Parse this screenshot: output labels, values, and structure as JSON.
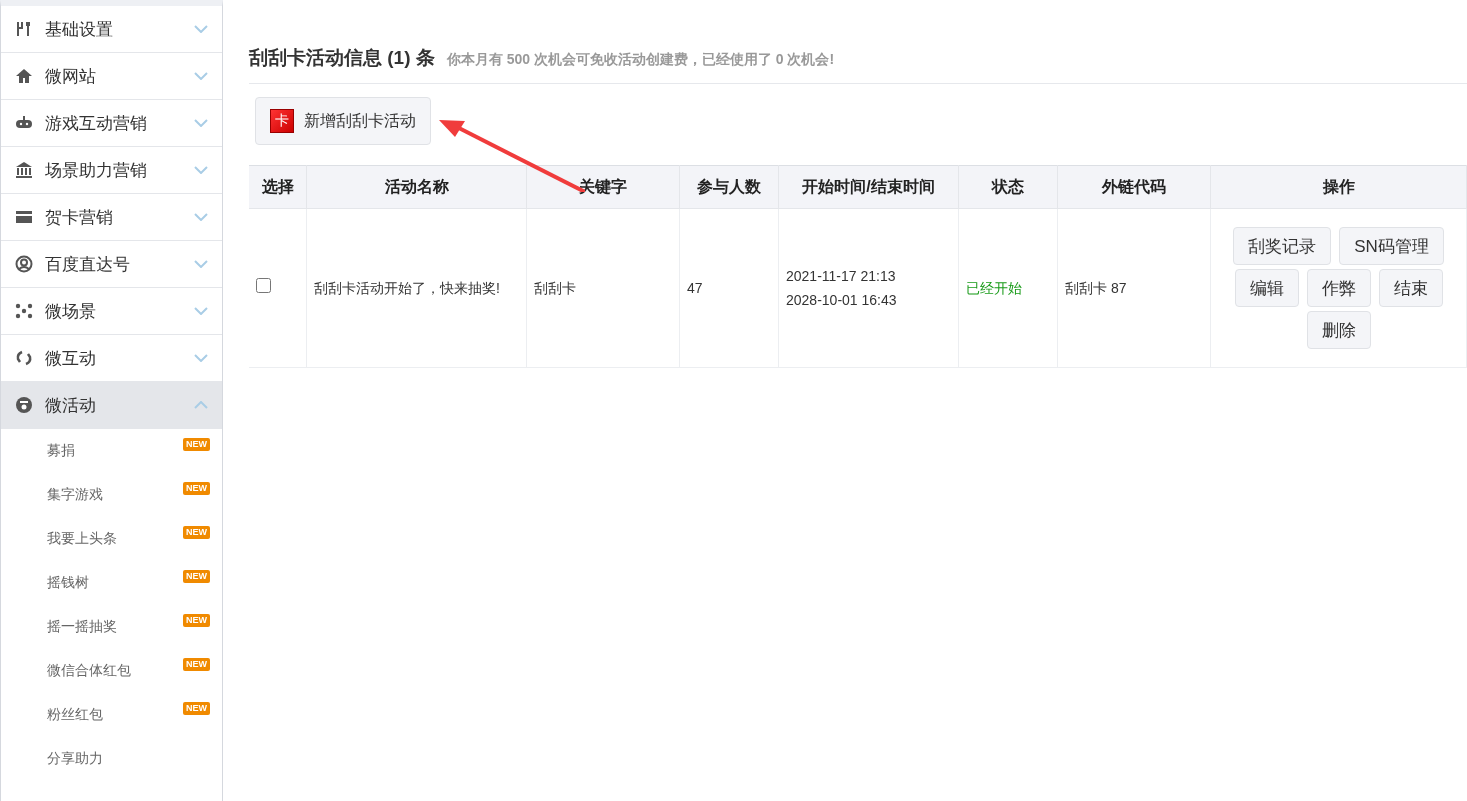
{
  "sidebar": {
    "items": [
      {
        "label": "基础设置",
        "expanded": false
      },
      {
        "label": "微网站",
        "expanded": false
      },
      {
        "label": "游戏互动营销",
        "expanded": false
      },
      {
        "label": "场景助力营销",
        "expanded": false
      },
      {
        "label": "贺卡营销",
        "expanded": false
      },
      {
        "label": "百度直达号",
        "expanded": false
      },
      {
        "label": "微场景",
        "expanded": false
      },
      {
        "label": "微互动",
        "expanded": false
      },
      {
        "label": "微活动",
        "expanded": true,
        "children": [
          {
            "label": "募捐",
            "badge": "NEW"
          },
          {
            "label": "集字游戏",
            "badge": "NEW"
          },
          {
            "label": "我要上头条",
            "badge": "NEW"
          },
          {
            "label": "摇钱树",
            "badge": "NEW"
          },
          {
            "label": "摇一摇抽奖",
            "badge": "NEW"
          },
          {
            "label": "微信合体红包",
            "badge": "NEW"
          },
          {
            "label": "粉丝红包",
            "badge": "NEW"
          },
          {
            "label": "分享助力"
          }
        ]
      }
    ]
  },
  "header": {
    "title": "刮刮卡活动信息 (1) 条",
    "note": "你本月有 500 次机会可免收活动创建费，已经使用了 0 次机会!"
  },
  "add_button": {
    "icon_text": "卡",
    "label": "新增刮刮卡活动"
  },
  "table": {
    "columns": [
      "选择",
      "活动名称",
      "关键字",
      "参与人数",
      "开始时间/结束时间",
      "状态",
      "外链代码",
      "操作"
    ],
    "rows": [
      {
        "checked": false,
        "name": "刮刮卡活动开始了，快来抽奖!",
        "keyword": "刮刮卡",
        "participants": "47",
        "start": "2021-11-17 21:13",
        "end": "2028-10-01 16:43",
        "status": "已经开始",
        "color": "#1a9b1a",
        "link_code": "刮刮卡 87",
        "actions": [
          [
            "刮奖记录",
            "SN码管理"
          ],
          [
            "编辑",
            "作弊",
            "结束"
          ],
          [
            "删除"
          ]
        ]
      }
    ]
  }
}
